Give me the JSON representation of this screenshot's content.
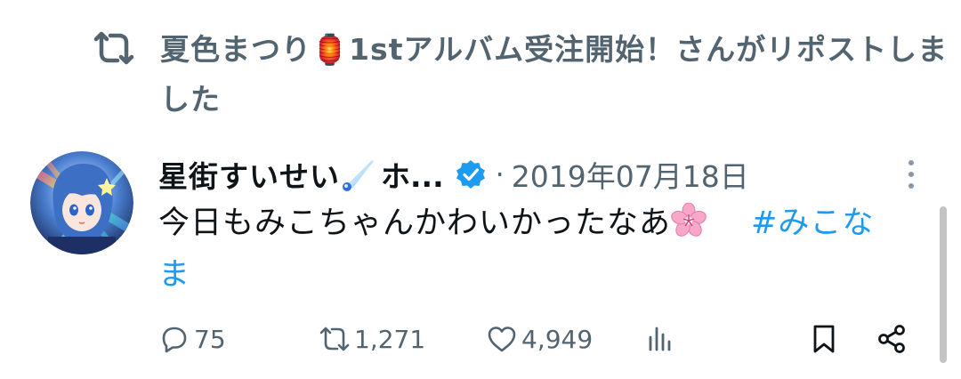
{
  "repost_banner": {
    "text": "夏色まつり🏮1stアルバム受注開始！さんがリポストしました",
    "icon": "repost-icon"
  },
  "tweet": {
    "author": {
      "display_name": "星街すいせい",
      "name_suffix": "ホ...",
      "verified": true
    },
    "separator": "·",
    "date": "2019年07月18日",
    "text_body": "今日もみこちゃんかわいかったなあ",
    "hashtag": "#みこなま",
    "emoji_icon": "cherry-blossom-icon"
  },
  "actions": {
    "reply_count": "75",
    "repost_count": "1,271",
    "like_count": "4,949"
  },
  "colors": {
    "text_primary": "#0f1419",
    "text_secondary": "#536471",
    "accent": "#1d9bf0"
  }
}
